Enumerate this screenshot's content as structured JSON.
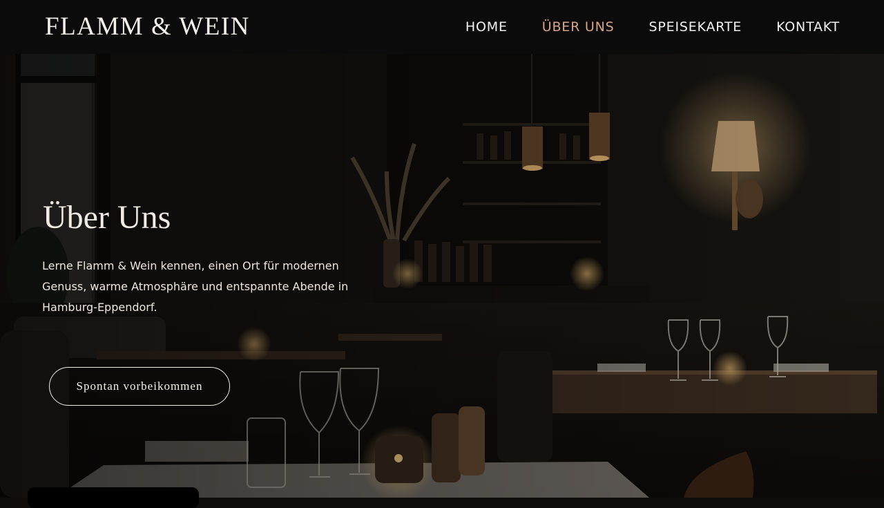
{
  "brand": {
    "logo": "FLAMM & WEIN"
  },
  "nav": {
    "items": [
      {
        "label": "HOME",
        "active": false
      },
      {
        "label": "ÜBER UNS",
        "active": true
      },
      {
        "label": "SPEISEKARTE",
        "active": false
      },
      {
        "label": "KONTAKT",
        "active": false
      }
    ]
  },
  "hero": {
    "title": "Über Uns",
    "text": "Lerne Flamm & Wein kennen, einen Ort für modernen Genuss, warme Atmosphäre und entspannte Abende in Hamburg-Eppendorf.",
    "cta_label": "Spontan vorbeikommen"
  },
  "colors": {
    "header_bg": "#0b0b0b",
    "accent": "#d9a488",
    "text_light": "#f1ebe3"
  }
}
